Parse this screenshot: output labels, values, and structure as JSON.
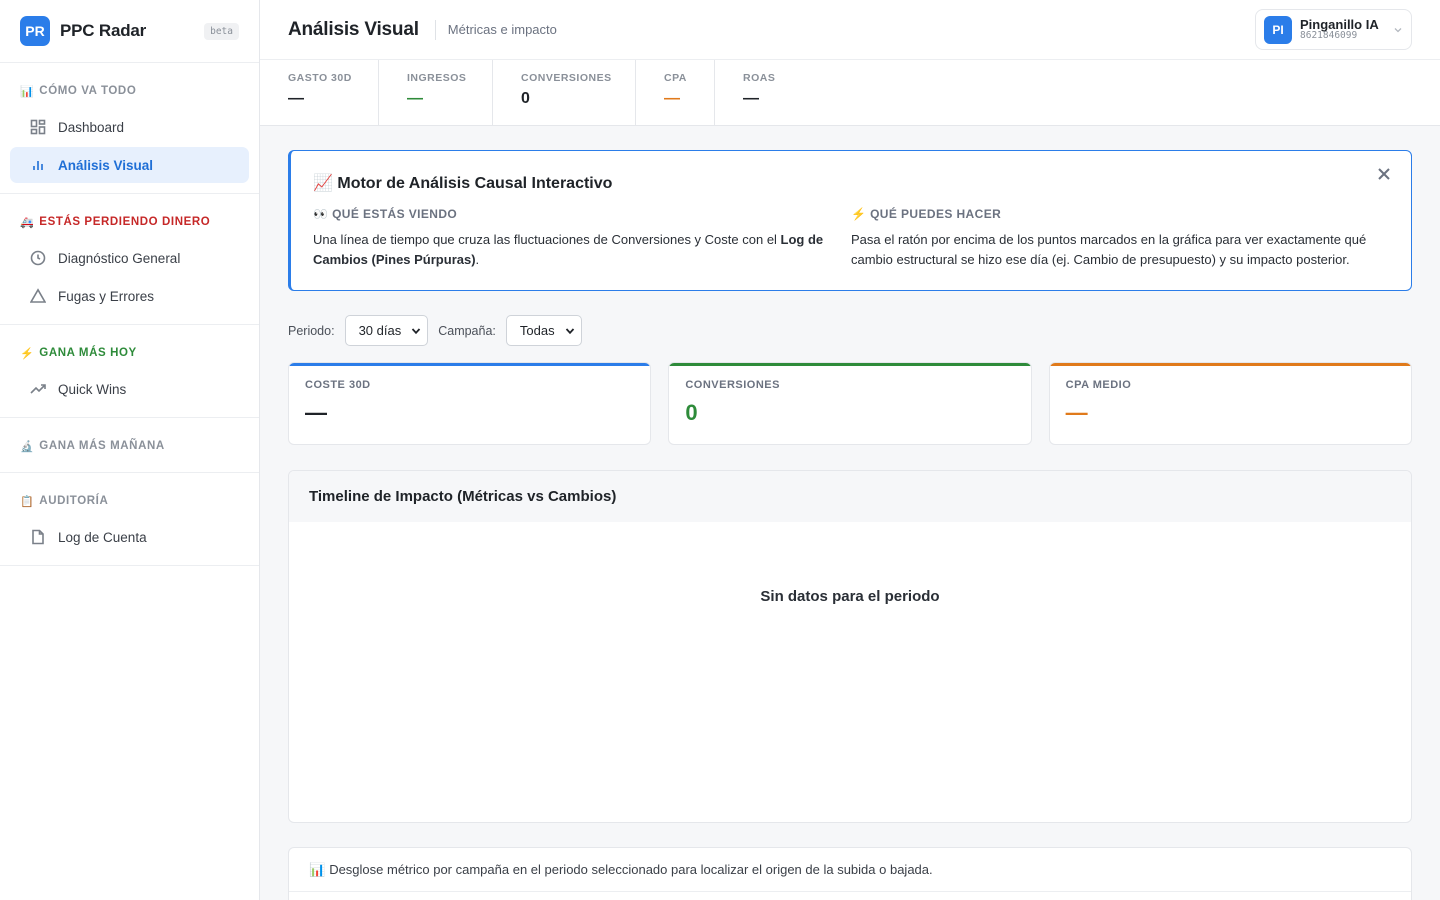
{
  "brand": {
    "logo": "PR",
    "name": "PPC Radar",
    "badge": "beta"
  },
  "sidebar": {
    "sections": [
      {
        "emoji": "📊",
        "title": "CÓMO VA TODO",
        "items": [
          {
            "label": "Dashboard",
            "icon": "dashboard-icon"
          },
          {
            "label": "Análisis Visual",
            "icon": "bar-chart-icon",
            "active": true
          }
        ]
      },
      {
        "emoji": "🚑",
        "title": "ESTÁS PERDIENDO DINERO",
        "items": [
          {
            "label": "Diagnóstico General",
            "icon": "clock-icon"
          },
          {
            "label": "Fugas y Errores",
            "icon": "warning-icon"
          }
        ]
      },
      {
        "emoji": "⚡",
        "title": "GANA MÁS HOY",
        "items": [
          {
            "label": "Quick Wins",
            "icon": "trending-up-icon"
          }
        ]
      },
      {
        "emoji": "🔬",
        "title": "GANA MÁS MAÑANA",
        "items": []
      },
      {
        "emoji": "📋",
        "title": "AUDITORÍA",
        "items": [
          {
            "label": "Log de Cuenta",
            "icon": "file-icon"
          }
        ]
      }
    ]
  },
  "header": {
    "title": "Análisis Visual",
    "subtitle": "Métricas e impacto",
    "account": {
      "avatar": "PI",
      "name": "Pinganillo IA",
      "id": "8621846099"
    }
  },
  "kpis": [
    {
      "label": "GASTO 30D",
      "value": "—"
    },
    {
      "label": "INGRESOS",
      "value": "—"
    },
    {
      "label": "CONVERSIONES",
      "value": "0"
    },
    {
      "label": "CPA",
      "value": "—"
    },
    {
      "label": "ROAS",
      "value": "—"
    }
  ],
  "info": {
    "emoji": "📈",
    "title": "Motor de Análisis Causal Interactivo",
    "left_title": "👀 QUÉ ESTÁS VIENDO",
    "left_text_a": "Una línea de tiempo que cruza las fluctuaciones de Conversiones y Coste con el ",
    "left_text_bold": "Log de Cambios (Pines Púrpuras)",
    "left_text_b": ".",
    "right_title": "⚡ QUÉ PUEDES HACER",
    "right_text": "Pasa el ratón por encima de los puntos marcados en la gráfica para ver exactamente qué cambio estructural se hizo ese día (ej. Cambio de presupuesto) y su impacto posterior."
  },
  "filters": {
    "period_label": "Periodo:",
    "period_value": "30 días",
    "campaign_label": "Campaña:",
    "campaign_value": "Todas"
  },
  "cards": [
    {
      "label": "COSTE 30D",
      "value": "—"
    },
    {
      "label": "CONVERSIONES",
      "value": "0"
    },
    {
      "label": "CPA MEDIO",
      "value": "—"
    }
  ],
  "timeline": {
    "title": "Timeline de Impacto (Métricas vs Cambios)",
    "empty": "Sin datos para el periodo"
  },
  "breakdown": {
    "emoji": "📊",
    "text": "Desglose métrico por campaña en el periodo seleccionado para localizar el origen de la subida o bajada."
  },
  "colors": {
    "accent": "#2b7de9",
    "green": "#2e8b3a",
    "orange": "#e07a1b",
    "red": "#c62828"
  }
}
